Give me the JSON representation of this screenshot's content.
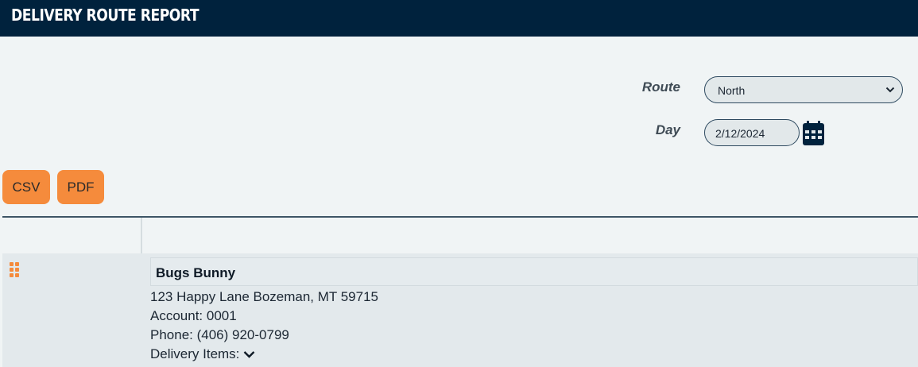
{
  "header": {
    "title": "DELIVERY ROUTE REPORT"
  },
  "filters": {
    "route_label": "Route",
    "route_value": "North",
    "day_label": "Day",
    "day_value": "2/12/2024"
  },
  "actions": {
    "csv_label": "CSV",
    "pdf_label": "PDF"
  },
  "colors": {
    "header_bg": "#00223d",
    "accent": "#f58b3c",
    "page_bg": "#f0f4f5"
  },
  "icons": {
    "calendar": "calendar-icon",
    "dropdown": "chevron-down-icon",
    "drag": "drag-handle-icon",
    "expand": "chevron-down-icon"
  },
  "deliveries": [
    {
      "name": "Bugs Bunny",
      "address": "123 Happy Lane Bozeman, MT 59715",
      "account": "Account: 0001",
      "phone": "Phone: (406) 920-0799",
      "items_label": "Delivery Items:"
    }
  ]
}
